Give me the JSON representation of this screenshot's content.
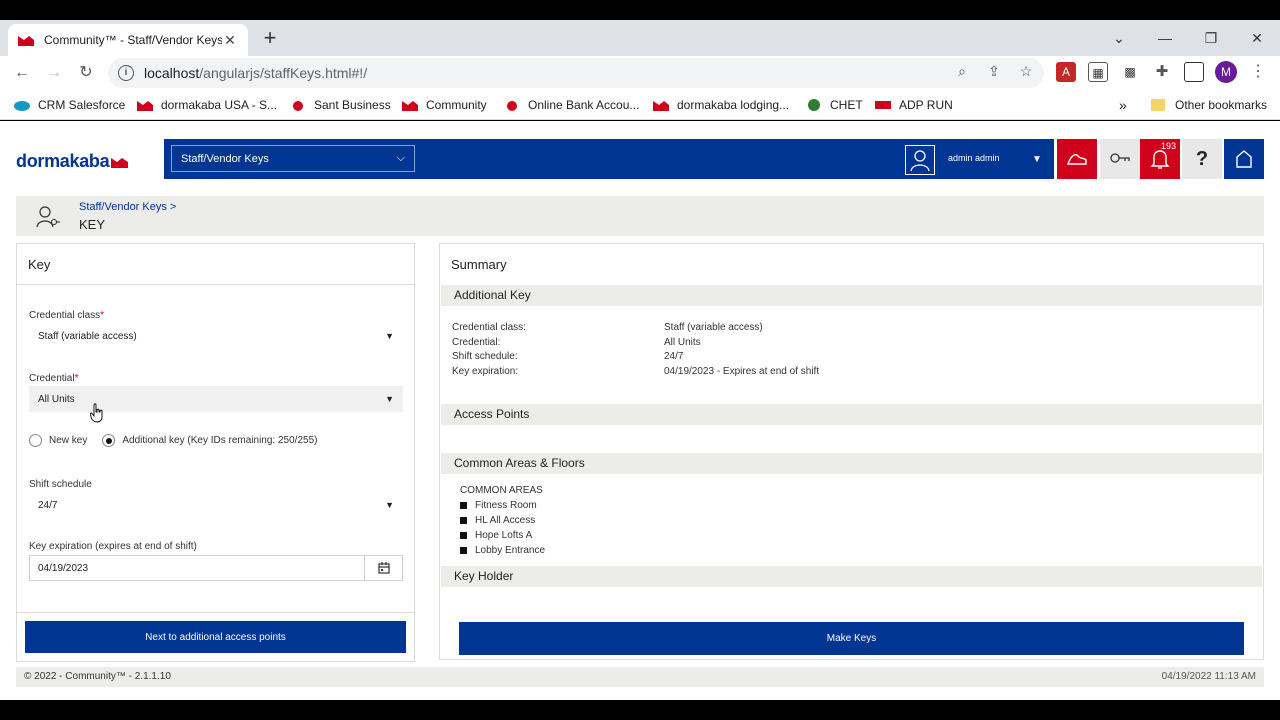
{
  "browser": {
    "tab_title": "Community™ - Staff/Vendor Keys",
    "url_host": "localhost",
    "url_path": "/angularjs/staffKeys.html#!/",
    "profile_initial": "M",
    "bookmarks": [
      {
        "label": "CRM Salesforce",
        "icon_color": "#1798c1"
      },
      {
        "label": "dormakaba USA - S...",
        "icon_color": "#d0021b"
      },
      {
        "label": "Sant Business",
        "icon_color": "#d0021b"
      },
      {
        "label": "Community",
        "icon_color": "#d0021b"
      },
      {
        "label": "Online Bank Accou...",
        "icon_color": "#d0021b"
      },
      {
        "label": "dormakaba lodging...",
        "icon_color": "#d0021b"
      },
      {
        "label": "CHET",
        "icon_color": "#2e7d32"
      },
      {
        "label": "ADP RUN",
        "icon_color": "#d0021b"
      }
    ],
    "overflow_label": "»",
    "other_bookmarks": "Other bookmarks"
  },
  "app": {
    "brand": "dormakaba",
    "module_select": "Staff/Vendor Keys",
    "user_name": "admin admin",
    "notification_count": "193",
    "breadcrumb_link": "Staff/Vendor Keys >",
    "breadcrumb_title": "KEY"
  },
  "key_panel": {
    "heading": "Key",
    "credential_class_label": "Credential class",
    "credential_class_value": "Staff (variable access)",
    "credential_label": "Credential",
    "credential_value": "All Units",
    "radio_new": "New key",
    "radio_additional": "Additional key (Key IDs remaining: 250/255)",
    "shift_label": "Shift schedule",
    "shift_value": "24/7",
    "expiration_label": "Key expiration (expires at end of shift)",
    "expiration_value": "04/19/2023",
    "next_button": "Next to additional access points",
    "required_mark": "*"
  },
  "summary": {
    "heading": "Summary",
    "additional_key_header": "Additional Key",
    "rows": [
      {
        "label": "Credential class:",
        "value": "Staff (variable access)"
      },
      {
        "label": "Credential:",
        "value": "All Units"
      },
      {
        "label": "Shift schedule:",
        "value": "24/7"
      },
      {
        "label": "Key expiration:",
        "value": "04/19/2023 - Expires at end of shift"
      }
    ],
    "access_points_header": "Access Points",
    "common_areas_header": "Common Areas & Floors",
    "common_areas_title": "COMMON AREAS",
    "common_areas": [
      "Fitness Room",
      "HL All Access",
      "Hope Lofts A",
      "Lobby Entrance"
    ],
    "key_holder_header": "Key Holder",
    "make_keys_button": "Make Keys"
  },
  "footer": {
    "left": "© 2022 - Community™ - 2.1.1.10",
    "right": "04/19/2022 11:13 AM"
  },
  "colors": {
    "brand_blue": "#003594",
    "brand_red": "#d0021b",
    "panel_grey": "#ecece8"
  }
}
